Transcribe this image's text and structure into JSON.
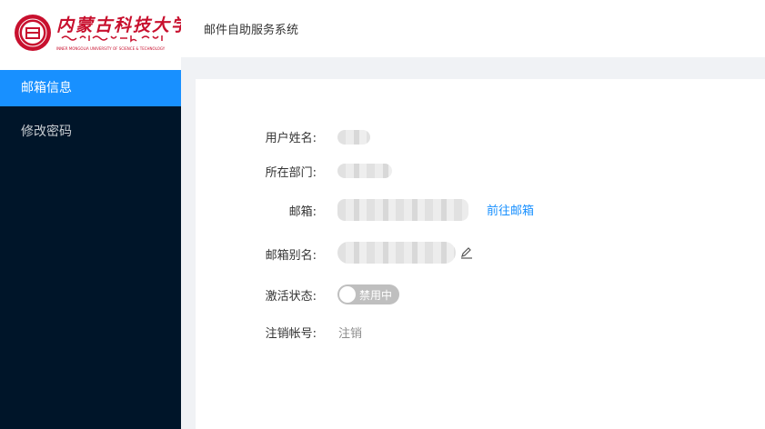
{
  "logo": {
    "title_cn": "内蒙古科技大学",
    "title_en": "INNER MONGOLIA UNIVERSITY OF SCIENCE & TECHNOLOGY"
  },
  "header": {
    "title": "邮件自助服务系统"
  },
  "sidebar": {
    "items": [
      {
        "label": "邮箱信息"
      },
      {
        "label": "修改密码"
      }
    ]
  },
  "form": {
    "username_label": "用户姓名:",
    "department_label": "所在部门:",
    "email_label": "邮箱:",
    "email_link": "前往邮箱",
    "alias_label": "邮箱别名:",
    "alias_edit_icon": "pencil-icon",
    "status_label": "激活状态:",
    "status_switch_text": "禁用中",
    "status_enabled": false,
    "cancel_label": "注销帐号:",
    "cancel_action": "注销"
  },
  "colors": {
    "sidebar_bg": "#001529",
    "active_nav": "#1890ff",
    "brand_red": "#c8102e",
    "link": "#1890ff",
    "switch_off": "#bfbfbf"
  }
}
